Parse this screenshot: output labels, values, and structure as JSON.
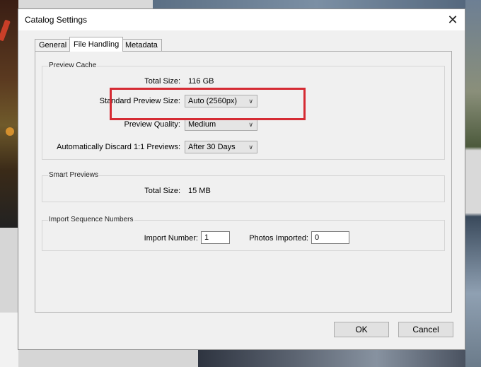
{
  "dialog": {
    "title": "Catalog Settings",
    "close_glyph": "✕"
  },
  "tabs": [
    {
      "label": "General",
      "active": false
    },
    {
      "label": "File Handling",
      "active": true
    },
    {
      "label": "Metadata",
      "active": false
    }
  ],
  "preview_cache": {
    "legend": "Preview Cache",
    "total_size_label": "Total Size:",
    "total_size_value": "116 GB",
    "standard_preview_label": "Standard Preview Size:",
    "standard_preview_value": "Auto (2560px)",
    "quality_label": "Preview Quality:",
    "quality_value": "Medium",
    "discard_label": "Automatically Discard 1:1 Previews:",
    "discard_value": "After 30 Days"
  },
  "smart_previews": {
    "legend": "Smart Previews",
    "total_size_label": "Total Size:",
    "total_size_value": "15 MB"
  },
  "import_sequence": {
    "legend": "Import Sequence Numbers",
    "import_number_label": "Import Number:",
    "import_number_value": "1",
    "photos_imported_label": "Photos Imported:",
    "photos_imported_value": "0"
  },
  "buttons": {
    "ok": "OK",
    "cancel": "Cancel"
  },
  "annotation": {
    "highlight_color": "#d52b33"
  },
  "icons": {
    "dropdown": "chevron-down-icon",
    "close": "close-icon"
  }
}
